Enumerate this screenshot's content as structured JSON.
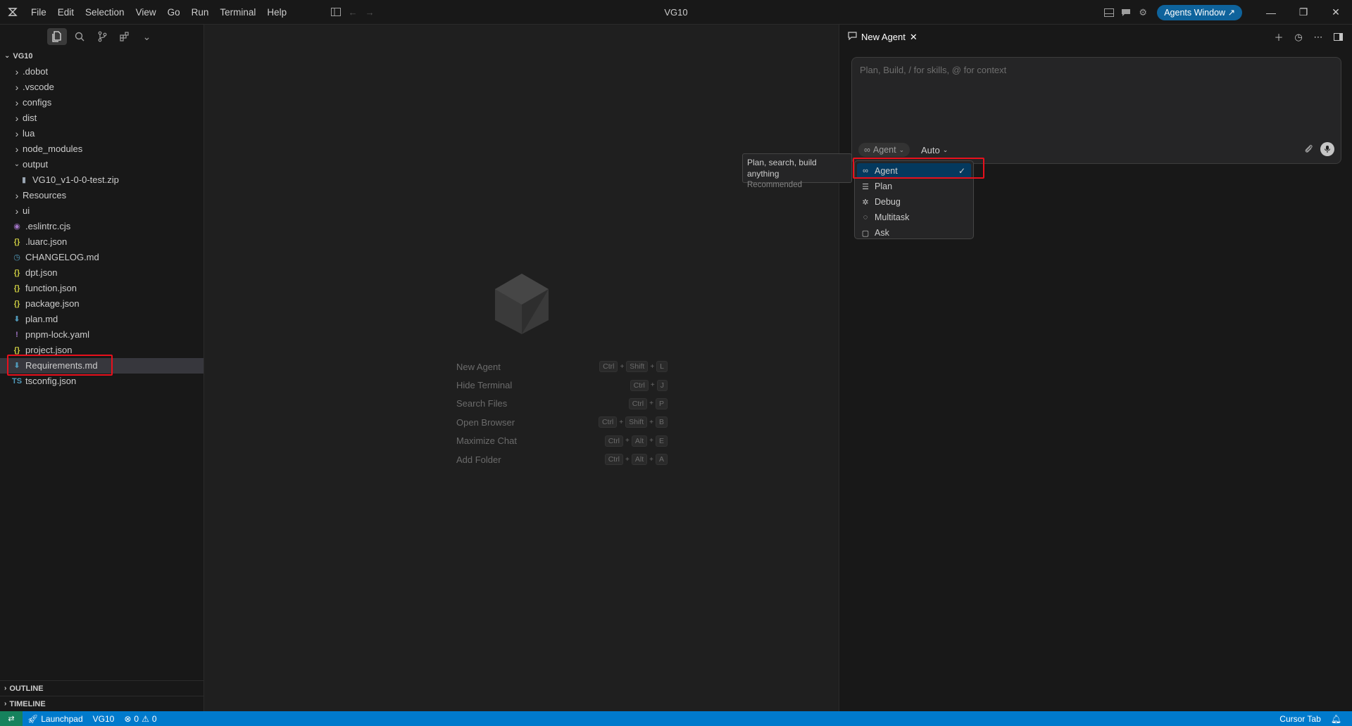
{
  "window": {
    "title": "VG10",
    "menu": [
      "File",
      "Edit",
      "Selection",
      "View",
      "Go",
      "Run",
      "Terminal",
      "Help"
    ],
    "agents_window_label": "Agents Window ↗"
  },
  "explorer": {
    "root_label": "VG10",
    "items": [
      {
        "label": ".dobot",
        "type": "folder",
        "icon": "chevron-right",
        "color": "#c5c5c5"
      },
      {
        "label": ".vscode",
        "type": "folder",
        "icon": "chevron-right",
        "color": "#c5c5c5"
      },
      {
        "label": "configs",
        "type": "folder",
        "icon": "chevron-right",
        "color": "#c5c5c5"
      },
      {
        "label": "dist",
        "type": "folder",
        "icon": "chevron-right",
        "color": "#c5c5c5"
      },
      {
        "label": "lua",
        "type": "folder",
        "icon": "chevron-right",
        "color": "#c5c5c5"
      },
      {
        "label": "node_modules",
        "type": "folder",
        "icon": "chevron-right",
        "color": "#c5c5c5"
      },
      {
        "label": "output",
        "type": "folder-open",
        "icon": "chevron-down",
        "color": "#c5c5c5"
      },
      {
        "label": "VG10_v1-0-0-test.zip",
        "type": "file-nested",
        "icon": "zip-icon",
        "glyph": "▮",
        "color": "#9aa6b2"
      },
      {
        "label": "Resources",
        "type": "folder",
        "icon": "chevron-right",
        "color": "#c5c5c5"
      },
      {
        "label": "ui",
        "type": "folder",
        "icon": "chevron-right",
        "color": "#c5c5c5"
      },
      {
        "label": ".eslintrc.cjs",
        "type": "file",
        "icon": "eslint-icon",
        "glyph": "◉",
        "color": "#a074c4"
      },
      {
        "label": ".luarc.json",
        "type": "file",
        "icon": "json-icon",
        "glyph": "{}",
        "color": "#cbcb41"
      },
      {
        "label": "CHANGELOG.md",
        "type": "file",
        "icon": "changelog-icon",
        "glyph": "◷",
        "color": "#519aba"
      },
      {
        "label": "dpt.json",
        "type": "file",
        "icon": "json-icon",
        "glyph": "{}",
        "color": "#cbcb41"
      },
      {
        "label": "function.json",
        "type": "file",
        "icon": "json-icon",
        "glyph": "{}",
        "color": "#cbcb41"
      },
      {
        "label": "package.json",
        "type": "file",
        "icon": "json-icon",
        "glyph": "{}",
        "color": "#cbcb41"
      },
      {
        "label": "plan.md",
        "type": "file",
        "icon": "markdown-icon",
        "glyph": "⬇",
        "color": "#519aba"
      },
      {
        "label": "pnpm-lock.yaml",
        "type": "file",
        "icon": "yaml-icon",
        "glyph": "!",
        "color": "#a074c4"
      },
      {
        "label": "project.json",
        "type": "file",
        "icon": "json-icon",
        "glyph": "{}",
        "color": "#cbcb41"
      },
      {
        "label": "Requirements.md",
        "type": "file",
        "icon": "markdown-icon",
        "glyph": "⬇",
        "color": "#519aba",
        "selected": true
      },
      {
        "label": "tsconfig.json",
        "type": "file",
        "icon": "tsconfig-icon",
        "glyph": "TS",
        "color": "#519aba"
      }
    ],
    "outline_label": "OUTLINE",
    "timeline_label": "TIMELINE"
  },
  "editor": {
    "shortcuts": [
      {
        "label": "New Agent",
        "keys": [
          "Ctrl",
          "Shift",
          "L"
        ]
      },
      {
        "label": "Hide Terminal",
        "keys": [
          "Ctrl",
          "J"
        ]
      },
      {
        "label": "Search Files",
        "keys": [
          "Ctrl",
          "P"
        ]
      },
      {
        "label": "Open Browser",
        "keys": [
          "Ctrl",
          "Shift",
          "B"
        ]
      },
      {
        "label": "Maximize Chat",
        "keys": [
          "Ctrl",
          "Alt",
          "E"
        ]
      },
      {
        "label": "Add Folder",
        "keys": [
          "Ctrl",
          "Alt",
          "A"
        ]
      }
    ]
  },
  "chat": {
    "tab_label": "New Agent",
    "composer_placeholder": "Plan, Build, / for skills, @ for context",
    "mode_label": "Agent",
    "model_label": "Auto",
    "tooltip_title": "Plan, search, build anything",
    "tooltip_sub": "Recommended",
    "modes": [
      {
        "label": "Agent",
        "icon": "infinity-icon",
        "glyph": "∞",
        "selected": true
      },
      {
        "label": "Plan",
        "icon": "plan-list-icon",
        "glyph": "☰",
        "selected": false
      },
      {
        "label": "Debug",
        "icon": "bug-icon",
        "glyph": "✲",
        "selected": false
      },
      {
        "label": "Multitask",
        "icon": "multitask-icon",
        "glyph": "◌",
        "selected": false
      },
      {
        "label": "Ask",
        "icon": "chat-bubble-icon",
        "glyph": "▢",
        "selected": false
      }
    ]
  },
  "statusbar": {
    "launchpad_label": "Launchpad",
    "project_label": "VG10",
    "errors": "0",
    "warnings": "0",
    "cursor_tab_label": "Cursor Tab"
  },
  "colors": {
    "accent": "#007acc",
    "highlight": "#e8101c",
    "selection": "#37373d"
  }
}
